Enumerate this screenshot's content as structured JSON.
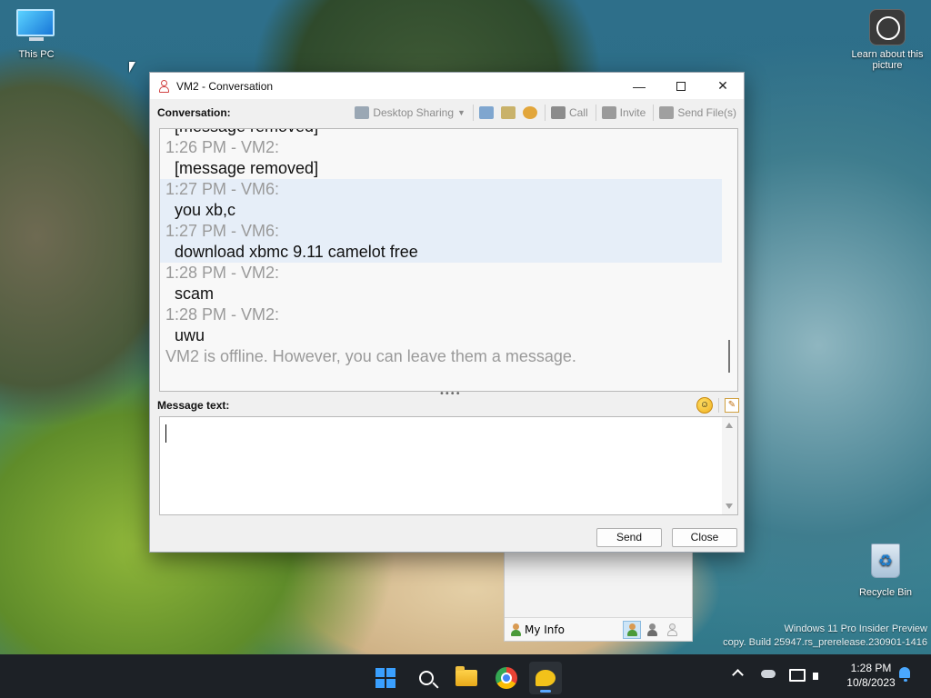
{
  "desktop": {
    "icons": [
      {
        "label": "This PC"
      },
      {
        "label": "Learn about this picture"
      },
      {
        "label": "Recycle Bin"
      }
    ],
    "watermark": {
      "line1": "Windows 11 Pro Insider Preview",
      "line2": "copy. Build 25947.rs_prerelease.230901-1416"
    }
  },
  "window": {
    "title": "VM2 - Conversation",
    "controls": {
      "minimize": "—",
      "maximize": "",
      "close": "✕"
    },
    "conversation_label": "Conversation:",
    "toolbar": {
      "desktop_sharing": "Desktop Sharing",
      "call": "Call",
      "invite": "Invite",
      "send_files": "Send File(s)"
    },
    "messages": [
      {
        "header": "",
        "text": "[message removed]",
        "highlighted": false
      },
      {
        "header": "1:26 PM - VM2:",
        "text": "[message removed]",
        "highlighted": false
      },
      {
        "header": "1:27 PM - VM6:",
        "text": "you xb,c",
        "highlighted": true
      },
      {
        "header": "1:27 PM - VM6:",
        "text": "download xbmc 9.11 camelot free",
        "highlighted": true
      },
      {
        "header": "1:28 PM - VM2:",
        "text": "scam",
        "highlighted": false
      },
      {
        "header": "1:28 PM - VM2:",
        "text": "uwu",
        "highlighted": false
      }
    ],
    "offline_notice": "VM2 is offline. However, you can leave them a message.",
    "message_text_label": "Message text:",
    "message_input_value": "",
    "buttons": {
      "send": "Send",
      "close": "Close"
    }
  },
  "contact_list": {
    "my_info": "My Info"
  },
  "taskbar": {
    "clock_time": "1:28 PM",
    "clock_date": "10/8/2023"
  },
  "colors": {
    "accent": "#3aa0ff",
    "highlight_row": "#e6eef8",
    "timestamp_gray": "#9a9a9a"
  }
}
